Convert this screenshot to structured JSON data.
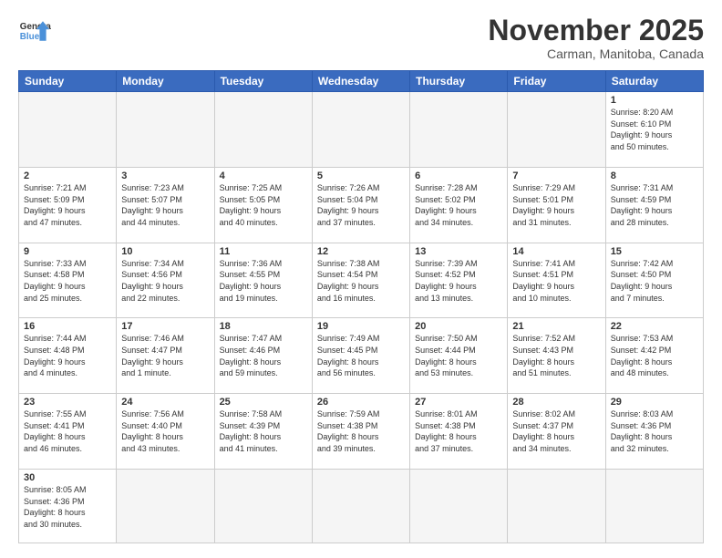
{
  "header": {
    "logo_general": "General",
    "logo_blue": "Blue",
    "month_title": "November 2025",
    "subtitle": "Carman, Manitoba, Canada"
  },
  "weekdays": [
    "Sunday",
    "Monday",
    "Tuesday",
    "Wednesday",
    "Thursday",
    "Friday",
    "Saturday"
  ],
  "weeks": [
    [
      {
        "day": "",
        "info": "",
        "empty": true
      },
      {
        "day": "",
        "info": "",
        "empty": true
      },
      {
        "day": "",
        "info": "",
        "empty": true
      },
      {
        "day": "",
        "info": "",
        "empty": true
      },
      {
        "day": "",
        "info": "",
        "empty": true
      },
      {
        "day": "",
        "info": "",
        "empty": true
      },
      {
        "day": "1",
        "info": "Sunrise: 8:20 AM\nSunset: 6:10 PM\nDaylight: 9 hours\nand 50 minutes."
      }
    ],
    [
      {
        "day": "2",
        "info": "Sunrise: 7:21 AM\nSunset: 5:09 PM\nDaylight: 9 hours\nand 47 minutes."
      },
      {
        "day": "3",
        "info": "Sunrise: 7:23 AM\nSunset: 5:07 PM\nDaylight: 9 hours\nand 44 minutes."
      },
      {
        "day": "4",
        "info": "Sunrise: 7:25 AM\nSunset: 5:05 PM\nDaylight: 9 hours\nand 40 minutes."
      },
      {
        "day": "5",
        "info": "Sunrise: 7:26 AM\nSunset: 5:04 PM\nDaylight: 9 hours\nand 37 minutes."
      },
      {
        "day": "6",
        "info": "Sunrise: 7:28 AM\nSunset: 5:02 PM\nDaylight: 9 hours\nand 34 minutes."
      },
      {
        "day": "7",
        "info": "Sunrise: 7:29 AM\nSunset: 5:01 PM\nDaylight: 9 hours\nand 31 minutes."
      },
      {
        "day": "8",
        "info": "Sunrise: 7:31 AM\nSunset: 4:59 PM\nDaylight: 9 hours\nand 28 minutes."
      }
    ],
    [
      {
        "day": "9",
        "info": "Sunrise: 7:33 AM\nSunset: 4:58 PM\nDaylight: 9 hours\nand 25 minutes."
      },
      {
        "day": "10",
        "info": "Sunrise: 7:34 AM\nSunset: 4:56 PM\nDaylight: 9 hours\nand 22 minutes."
      },
      {
        "day": "11",
        "info": "Sunrise: 7:36 AM\nSunset: 4:55 PM\nDaylight: 9 hours\nand 19 minutes."
      },
      {
        "day": "12",
        "info": "Sunrise: 7:38 AM\nSunset: 4:54 PM\nDaylight: 9 hours\nand 16 minutes."
      },
      {
        "day": "13",
        "info": "Sunrise: 7:39 AM\nSunset: 4:52 PM\nDaylight: 9 hours\nand 13 minutes."
      },
      {
        "day": "14",
        "info": "Sunrise: 7:41 AM\nSunset: 4:51 PM\nDaylight: 9 hours\nand 10 minutes."
      },
      {
        "day": "15",
        "info": "Sunrise: 7:42 AM\nSunset: 4:50 PM\nDaylight: 9 hours\nand 7 minutes."
      }
    ],
    [
      {
        "day": "16",
        "info": "Sunrise: 7:44 AM\nSunset: 4:48 PM\nDaylight: 9 hours\nand 4 minutes."
      },
      {
        "day": "17",
        "info": "Sunrise: 7:46 AM\nSunset: 4:47 PM\nDaylight: 9 hours\nand 1 minute."
      },
      {
        "day": "18",
        "info": "Sunrise: 7:47 AM\nSunset: 4:46 PM\nDaylight: 8 hours\nand 59 minutes."
      },
      {
        "day": "19",
        "info": "Sunrise: 7:49 AM\nSunset: 4:45 PM\nDaylight: 8 hours\nand 56 minutes."
      },
      {
        "day": "20",
        "info": "Sunrise: 7:50 AM\nSunset: 4:44 PM\nDaylight: 8 hours\nand 53 minutes."
      },
      {
        "day": "21",
        "info": "Sunrise: 7:52 AM\nSunset: 4:43 PM\nDaylight: 8 hours\nand 51 minutes."
      },
      {
        "day": "22",
        "info": "Sunrise: 7:53 AM\nSunset: 4:42 PM\nDaylight: 8 hours\nand 48 minutes."
      }
    ],
    [
      {
        "day": "23",
        "info": "Sunrise: 7:55 AM\nSunset: 4:41 PM\nDaylight: 8 hours\nand 46 minutes."
      },
      {
        "day": "24",
        "info": "Sunrise: 7:56 AM\nSunset: 4:40 PM\nDaylight: 8 hours\nand 43 minutes."
      },
      {
        "day": "25",
        "info": "Sunrise: 7:58 AM\nSunset: 4:39 PM\nDaylight: 8 hours\nand 41 minutes."
      },
      {
        "day": "26",
        "info": "Sunrise: 7:59 AM\nSunset: 4:38 PM\nDaylight: 8 hours\nand 39 minutes."
      },
      {
        "day": "27",
        "info": "Sunrise: 8:01 AM\nSunset: 4:38 PM\nDaylight: 8 hours\nand 37 minutes."
      },
      {
        "day": "28",
        "info": "Sunrise: 8:02 AM\nSunset: 4:37 PM\nDaylight: 8 hours\nand 34 minutes."
      },
      {
        "day": "29",
        "info": "Sunrise: 8:03 AM\nSunset: 4:36 PM\nDaylight: 8 hours\nand 32 minutes."
      }
    ],
    [
      {
        "day": "30",
        "info": "Sunrise: 8:05 AM\nSunset: 4:36 PM\nDaylight: 8 hours\nand 30 minutes."
      },
      {
        "day": "",
        "info": "",
        "empty": true
      },
      {
        "day": "",
        "info": "",
        "empty": true
      },
      {
        "day": "",
        "info": "",
        "empty": true
      },
      {
        "day": "",
        "info": "",
        "empty": true
      },
      {
        "day": "",
        "info": "",
        "empty": true
      },
      {
        "day": "",
        "info": "",
        "empty": true
      }
    ]
  ]
}
